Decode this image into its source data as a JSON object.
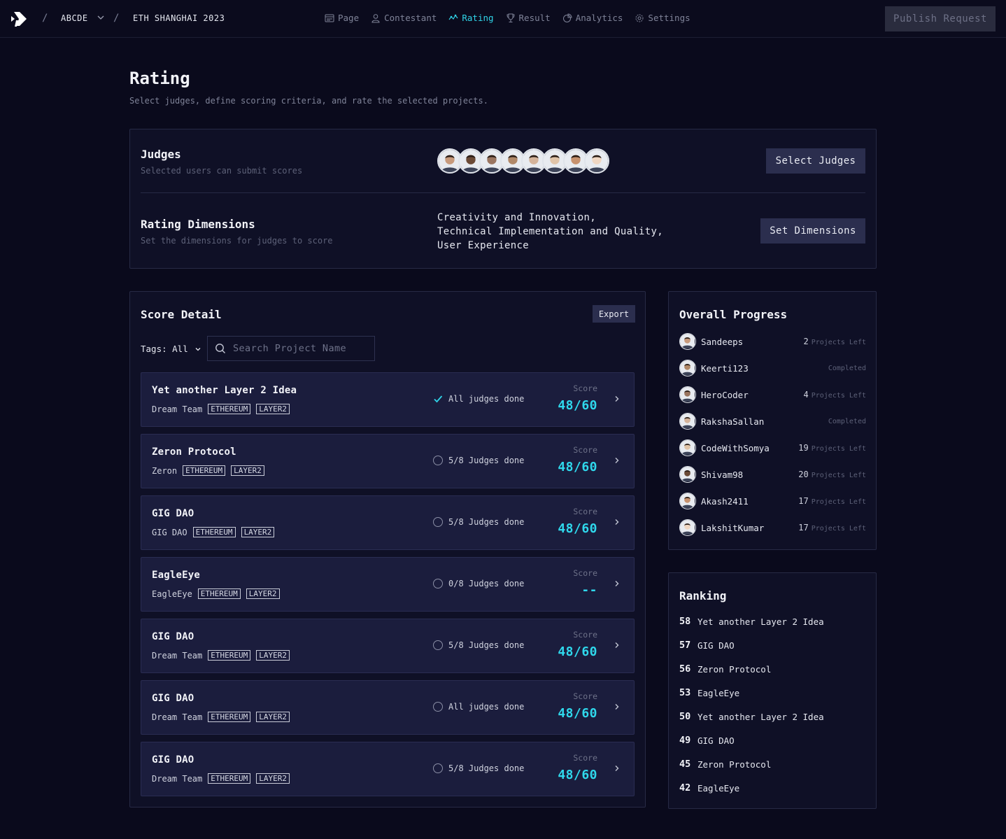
{
  "breadcrumb": {
    "org": "ABCDE",
    "event": "ETH SHANGHAI 2023"
  },
  "nav": [
    {
      "label": "Page",
      "icon": "page-icon"
    },
    {
      "label": "Contestant",
      "icon": "user-icon"
    },
    {
      "label": "Rating",
      "icon": "rating-icon",
      "active": true
    },
    {
      "label": "Result",
      "icon": "trophy-icon"
    },
    {
      "label": "Analytics",
      "icon": "analytics-icon"
    },
    {
      "label": "Settings",
      "icon": "gear-icon"
    }
  ],
  "publish_label": "Publish Request",
  "header": {
    "title": "Rating",
    "subtitle": "Select judges, define scoring criteria, and rate the selected projects."
  },
  "judges": {
    "title": "Judges",
    "subtitle": "Selected users can submit scores",
    "button": "Select Judges",
    "avatar_colors": [
      "#c79a7c",
      "#6b4a36",
      "#9a7560",
      "#b08868",
      "#d4b39a",
      "#e0c4a8",
      "#c7926e",
      "#f0d7c2"
    ]
  },
  "dimensions": {
    "title": "Rating Dimensions",
    "subtitle": "Set the dimensions for judges to score",
    "lines": [
      "Creativity and Innovation,",
      "Technical Implementation and Quality,",
      "User Experience"
    ],
    "button": "Set Dimensions"
  },
  "score_detail": {
    "title": "Score Detail",
    "export_label": "Export",
    "tags_label": "Tags: All",
    "search_placeholder": "Search Project Name",
    "score_label": "Score",
    "projects": [
      {
        "name": "Yet another Layer 2 Idea",
        "team": "Dream Team",
        "tags": [
          "ETHEREUM",
          "LAYER2"
        ],
        "status": "All judges done",
        "done": true,
        "score": "48/60"
      },
      {
        "name": "Zeron Protocol",
        "team": "Zeron",
        "tags": [
          "ETHEREUM",
          "LAYER2"
        ],
        "status": "5/8 Judges done",
        "done": false,
        "score": "48/60"
      },
      {
        "name": "GIG DAO",
        "team": "GIG DAO",
        "tags": [
          "ETHEREUM",
          "LAYER2"
        ],
        "status": "5/8 Judges done",
        "done": false,
        "score": "48/60"
      },
      {
        "name": "EagleEye",
        "team": "EagleEye",
        "tags": [
          "ETHEREUM",
          "LAYER2"
        ],
        "status": "0/8 Judges done",
        "done": false,
        "score": "--"
      },
      {
        "name": "GIG DAO",
        "team": "Dream Team",
        "tags": [
          "ETHEREUM",
          "LAYER2"
        ],
        "status": "5/8 Judges done",
        "done": false,
        "score": "48/60"
      },
      {
        "name": "GIG DAO",
        "team": "Dream Team",
        "tags": [
          "ETHEREUM",
          "LAYER2"
        ],
        "status": "All judges done",
        "done": false,
        "score": "48/60"
      },
      {
        "name": "GIG DAO",
        "team": "Dream Team",
        "tags": [
          "ETHEREUM",
          "LAYER2"
        ],
        "status": "5/8 Judges done",
        "done": false,
        "score": "48/60"
      }
    ]
  },
  "progress": {
    "title": "Overall Progress",
    "left_suffix": "Projects Left",
    "completed_label": "Completed",
    "judges": [
      {
        "name": "Sandeeps",
        "left": "2"
      },
      {
        "name": "Keerti123",
        "left": null
      },
      {
        "name": "HeroCoder",
        "left": "4"
      },
      {
        "name": "RakshaSallan",
        "left": null
      },
      {
        "name": "CodeWithSomya",
        "left": "19"
      },
      {
        "name": "Shivam98",
        "left": "20"
      },
      {
        "name": "Akash2411",
        "left": "17"
      },
      {
        "name": "LakshitKumar",
        "left": "17"
      }
    ]
  },
  "ranking": {
    "title": "Ranking",
    "items": [
      {
        "score": "58",
        "name": "Yet another Layer 2 Idea"
      },
      {
        "score": "57",
        "name": "GIG DAO"
      },
      {
        "score": "56",
        "name": "Zeron Protocol"
      },
      {
        "score": "53",
        "name": "EagleEye"
      },
      {
        "score": "50",
        "name": "Yet another Layer 2 Idea"
      },
      {
        "score": "49",
        "name": "GIG DAO"
      },
      {
        "score": "45",
        "name": "Zeron Protocol"
      },
      {
        "score": "42",
        "name": "EagleEye"
      }
    ]
  }
}
